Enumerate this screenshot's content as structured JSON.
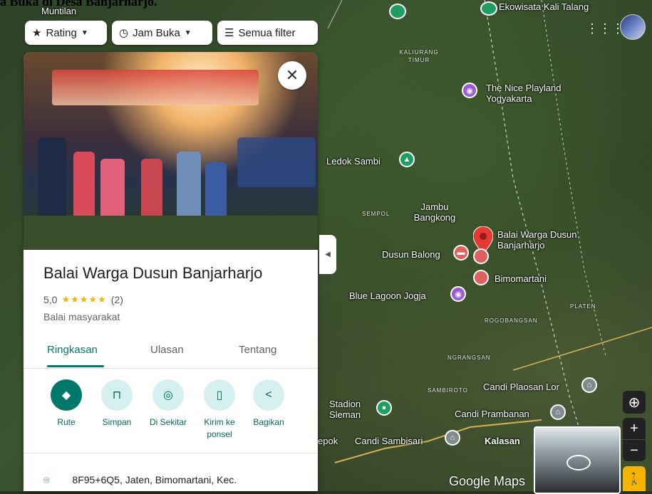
{
  "page_heading": "a Buka di Desa Banjarharjo.",
  "filters": [
    {
      "icon": "star-icon",
      "label": "Rating"
    },
    {
      "icon": "clock-icon",
      "label": "Jam Buka"
    },
    {
      "icon": "sliders-icon",
      "label": "Semua filter"
    }
  ],
  "place": {
    "name": "Balai Warga Dusun Banjarharjo",
    "rating": "5,0",
    "stars": "★★★★★",
    "review_count": "(2)",
    "category": "Balai masyarakat",
    "address": "8F95+6Q5, Jaten, Bimomartani, Kec."
  },
  "tabs": [
    "Ringkasan",
    "Ulasan",
    "Tentang"
  ],
  "actions": [
    {
      "label": "Rute",
      "icon": "directions-icon",
      "glyph": "◆"
    },
    {
      "label": "Simpan",
      "icon": "bookmark-icon",
      "glyph": "⊓"
    },
    {
      "label": "Di Sekitar",
      "icon": "nearby-icon",
      "glyph": "◎"
    },
    {
      "label": "Kirim ke ponsel",
      "icon": "phone-icon",
      "glyph": "▯"
    },
    {
      "label": "Bagikan",
      "icon": "share-icon",
      "glyph": "<"
    }
  ],
  "map_labels": {
    "muntilan": "Muntilan",
    "ekowisata": "Ekowisata Kali Talang",
    "kaliurang": "KALIURANG TIMUR",
    "nice_playland": "The Nice Playland Yogyakarta",
    "ledok_sambi": "Ledok Sambi",
    "jambu_bangkong": "Jambu Bangkong",
    "sempol": "SEMPOL",
    "balai_warga": "Balai Warga Dusun Banjarharjo",
    "dusun_balong": "Dusun Balong",
    "bimomartani": "Bimomartani",
    "blue_lagoon": "Blue Lagoon Jogja",
    "platen": "PLATEN",
    "rogobangsan": "ROGOBANGSAN",
    "ngrangsan": "NGRANGSAN",
    "sambiroto": "SAMBIROTO",
    "candi_plaosan": "Candi Plaosan Lor",
    "candi_prambanan": "Candi Prambanan",
    "stadion": "Stadion Sleman",
    "candi_sambisari": "Candi Sambisari",
    "kalasan": "Kalasan",
    "depok": "epok",
    "google_maps": "Google Maps"
  },
  "colors": {
    "accent": "#00796b",
    "star": "#f4b400",
    "map_pin": "#e53935"
  }
}
